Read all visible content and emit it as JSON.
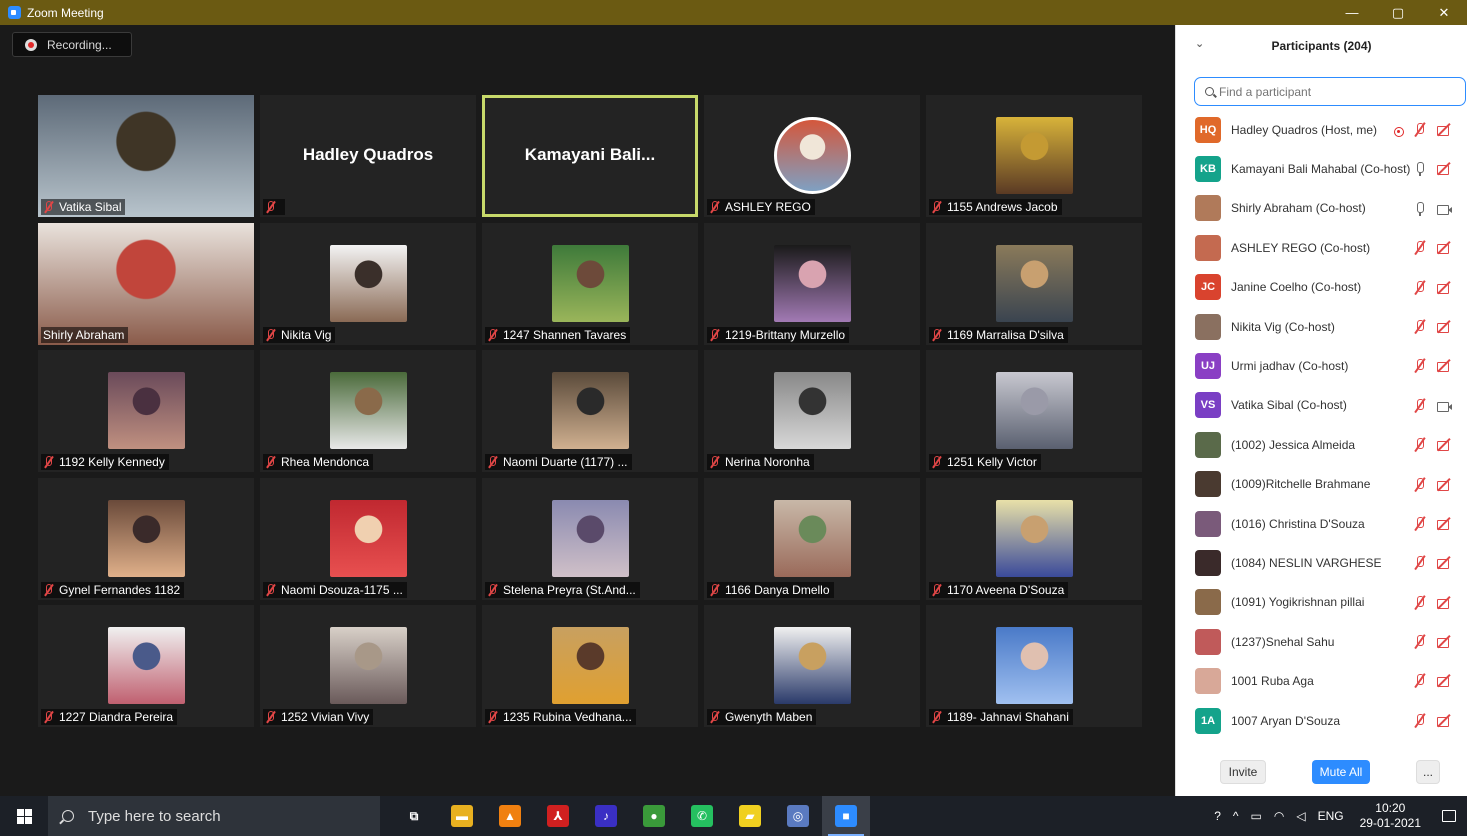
{
  "window": {
    "title": "Zoom Meeting",
    "minimize": "—",
    "maximize": "▢",
    "close": "✕"
  },
  "recording": {
    "label": "Recording..."
  },
  "tiles": [
    {
      "name": "Vatika Sibal",
      "kind": "video",
      "muted": true,
      "colors": [
        "#5d6a78",
        "#b8c4cc",
        "#3f3526"
      ]
    },
    {
      "name": "Hadley Quadros",
      "kind": "name",
      "muted": true,
      "big_name": "Hadley Quadros"
    },
    {
      "name": "Kamayani  Bali...",
      "kind": "name",
      "muted": false,
      "active": true,
      "big_name": "Kamayani  Bali..."
    },
    {
      "name": "ASHLEY REGO",
      "kind": "round",
      "muted": true,
      "colors": [
        "#d4573c",
        "#7fa0c2",
        "#f0e6d8"
      ]
    },
    {
      "name": "1155 Andrews Jacob",
      "kind": "photo",
      "muted": true,
      "colors": [
        "#d8b33a",
        "#5a3a24",
        "#c49a33"
      ]
    },
    {
      "name": "Shirly Abraham",
      "kind": "video",
      "muted": false,
      "colors": [
        "#e9e2dc",
        "#8a5b4a",
        "#c1453b"
      ]
    },
    {
      "name": "Nikita Vig",
      "kind": "photo",
      "muted": true,
      "colors": [
        "#f3f3f3",
        "#8a6a55",
        "#3a2f2a"
      ]
    },
    {
      "name": "1247 Shannen Tavares",
      "kind": "photo",
      "muted": true,
      "colors": [
        "#3e7a3a",
        "#9ab55a",
        "#6d4a3a"
      ]
    },
    {
      "name": "1219-Brittany Murzello",
      "kind": "photo",
      "muted": true,
      "colors": [
        "#1a1a1a",
        "#a27ab4",
        "#d9a3b0"
      ]
    },
    {
      "name": "1169 Marralisa D'silva",
      "kind": "photo",
      "muted": true,
      "colors": [
        "#8a7a5a",
        "#3a4450",
        "#c8a070"
      ]
    },
    {
      "name": "1192 Kelly Kennedy",
      "kind": "photo",
      "muted": true,
      "colors": [
        "#6a4a5a",
        "#c09080",
        "#4a3040"
      ]
    },
    {
      "name": "Rhea Mendonca",
      "kind": "photo",
      "muted": true,
      "colors": [
        "#4a6a3a",
        "#e8e8e8",
        "#8a6a4a"
      ]
    },
    {
      "name": "Naomi Duarte (1177) ...",
      "kind": "photo",
      "muted": true,
      "colors": [
        "#5a4a3a",
        "#d0b090",
        "#2a2a2a"
      ]
    },
    {
      "name": "Nerina Noronha",
      "kind": "photo",
      "muted": true,
      "colors": [
        "#888888",
        "#d8d8d8",
        "#333333"
      ]
    },
    {
      "name": "1251 Kelly Victor",
      "kind": "photo",
      "muted": true,
      "colors": [
        "#c8c8d0",
        "#5a6070",
        "#9a9aa8"
      ]
    },
    {
      "name": "Gynel Fernandes 1182",
      "kind": "photo",
      "muted": true,
      "colors": [
        "#6a4a3a",
        "#e0b08a",
        "#3a2a2a"
      ]
    },
    {
      "name": "Naomi Dsouza-1175 ...",
      "kind": "photo",
      "muted": true,
      "colors": [
        "#c02830",
        "#e85050",
        "#f0d0b0"
      ]
    },
    {
      "name": "Stelena Preyra (St.And...",
      "kind": "photo",
      "muted": true,
      "colors": [
        "#8a8ab0",
        "#d0c0c8",
        "#5a4a6a"
      ]
    },
    {
      "name": "1166 Danya Dmello",
      "kind": "photo",
      "muted": true,
      "colors": [
        "#c8b8a8",
        "#9a6a5a",
        "#6a8a5a"
      ]
    },
    {
      "name": "1170 Aveena D'Souza",
      "kind": "photo",
      "muted": true,
      "colors": [
        "#e8e0a8",
        "#3a4a9a",
        "#c8a070"
      ]
    },
    {
      "name": "1227 Diandra Pereira",
      "kind": "photo",
      "muted": true,
      "colors": [
        "#f0f0f0",
        "#c06070",
        "#4a5a8a"
      ]
    },
    {
      "name": "1252 Vivian Vivy",
      "kind": "photo",
      "muted": true,
      "colors": [
        "#d8d0c8",
        "#6a5a5a",
        "#a89888"
      ]
    },
    {
      "name": "1235 Rubina Vedhana...",
      "kind": "photo",
      "muted": true,
      "colors": [
        "#c8a060",
        "#e0a030",
        "#5a3a2a"
      ]
    },
    {
      "name": "Gwenyth Maben",
      "kind": "photo",
      "muted": true,
      "colors": [
        "#f0f0f0",
        "#2a3a6a",
        "#c8a060"
      ]
    },
    {
      "name": "1189- Jahnavi Shahani",
      "kind": "photo",
      "muted": true,
      "colors": [
        "#4a7ac8",
        "#a0c0f0",
        "#e0c0b0"
      ]
    }
  ],
  "panel": {
    "title": "Participants (204)",
    "collapse_icon": "⌄",
    "search_placeholder": "Find a participant",
    "participants": [
      {
        "name": "Hadley Quadros (Host, me)",
        "initials": "HQ",
        "color": "#e0692a",
        "recording": true,
        "mic": "off",
        "cam": "off"
      },
      {
        "name": "Kamayani Bali Mahabal (Co-host)",
        "initials": "KB",
        "color": "#14a38b",
        "mic": "on",
        "cam": "off"
      },
      {
        "name": "Shirly Abraham (Co-host)",
        "initials": "",
        "color": "#b07a5a",
        "mic": "on",
        "cam": "on"
      },
      {
        "name": "ASHLEY REGO (Co-host)",
        "initials": "",
        "color": "#c46a50",
        "mic": "off",
        "cam": "off"
      },
      {
        "name": "Janine Coelho (Co-host)",
        "initials": "JC",
        "color": "#d9432e",
        "mic": "off",
        "cam": "off"
      },
      {
        "name": "Nikita Vig (Co-host)",
        "initials": "",
        "color": "#8a7060",
        "mic": "off",
        "cam": "off"
      },
      {
        "name": "Urmi jadhav (Co-host)",
        "initials": "UJ",
        "color": "#8a3fc4",
        "mic": "off",
        "cam": "off"
      },
      {
        "name": "Vatika Sibal (Co-host)",
        "initials": "VS",
        "color": "#7a3fc4",
        "mic": "off",
        "cam": "on"
      },
      {
        "name": "(1002) Jessica Almeida",
        "initials": "",
        "color": "#5a6a4a",
        "mic": "off",
        "cam": "off"
      },
      {
        "name": "(1009)Ritchelle Brahmane",
        "initials": "",
        "color": "#4a3a30",
        "mic": "off",
        "cam": "off"
      },
      {
        "name": "(1016) Christina D'Souza",
        "initials": "",
        "color": "#7a5a7a",
        "mic": "off",
        "cam": "off"
      },
      {
        "name": "(1084) NESLIN VARGHESE",
        "initials": "",
        "color": "#3a2a2a",
        "mic": "off",
        "cam": "off"
      },
      {
        "name": "(1091) Yogikrishnan pillai",
        "initials": "",
        "color": "#8a6a4a",
        "mic": "off",
        "cam": "off"
      },
      {
        "name": "(1237)Snehal Sahu",
        "initials": "",
        "color": "#c05a5a",
        "mic": "off",
        "cam": "off"
      },
      {
        "name": "1001 Ruba Aga",
        "initials": "",
        "color": "#d8a898",
        "mic": "off",
        "cam": "off"
      },
      {
        "name": "1007 Aryan D'Souza",
        "initials": "1A",
        "color": "#14a38b",
        "mic": "off",
        "cam": "off"
      }
    ],
    "invite_label": "Invite",
    "mute_all_label": "Mute All",
    "more_label": "..."
  },
  "taskbar": {
    "search_placeholder": "Type here to search",
    "apps": [
      {
        "name": "task-view",
        "glyph": "⧉",
        "color": "#1c2027"
      },
      {
        "name": "file-explorer",
        "glyph": "▬",
        "color": "#e8b020"
      },
      {
        "name": "vlc",
        "glyph": "▲",
        "color": "#f08010"
      },
      {
        "name": "acrobat",
        "glyph": "⅄",
        "color": "#d02020"
      },
      {
        "name": "amazon-music",
        "glyph": "♪",
        "color": "#3a2fc4"
      },
      {
        "name": "chrome",
        "glyph": "●",
        "color": "#3a9a3a"
      },
      {
        "name": "whatsapp",
        "glyph": "✆",
        "color": "#25c060"
      },
      {
        "name": "sticky-notes",
        "glyph": "▰",
        "color": "#f0d020"
      },
      {
        "name": "edge-like",
        "glyph": "◎",
        "color": "#5a7ac0"
      },
      {
        "name": "zoom",
        "glyph": "■",
        "color": "#2d8cff"
      }
    ],
    "language": "ENG",
    "time": "10:20",
    "date": "29-01-2021"
  }
}
